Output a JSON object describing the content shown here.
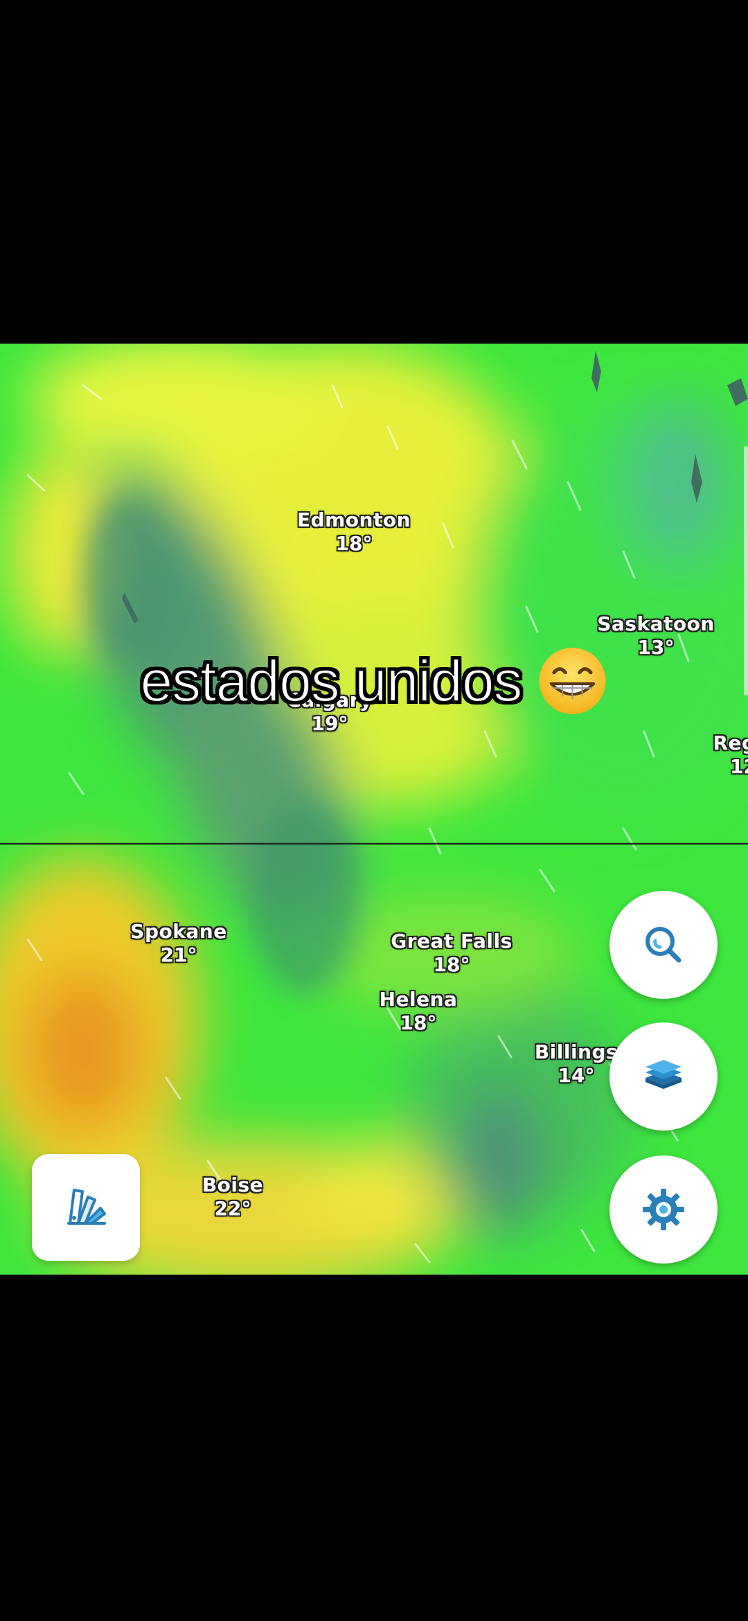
{
  "caption": {
    "text": "estados unidos",
    "emoji": "grinning-face-with-smiling-eyes"
  },
  "map": {
    "cities": [
      {
        "name": "Edmonton",
        "temp": "18°"
      },
      {
        "name": "Saskatoon",
        "temp": "13°"
      },
      {
        "name": "Calgary",
        "temp": "19°"
      },
      {
        "name": "Reg",
        "temp": "12"
      },
      {
        "name": "Spokane",
        "temp": "21°"
      },
      {
        "name": "Great Falls",
        "temp": "18°"
      },
      {
        "name": "Helena",
        "temp": "18°"
      },
      {
        "name": "Billings",
        "temp": "14°"
      },
      {
        "name": "Boise",
        "temp": "22°"
      }
    ]
  },
  "controls": {
    "search_icon": "search-location-icon",
    "layers_icon": "layers-icon",
    "settings_icon": "gear-icon",
    "legend_icon": "color-palette-icon"
  },
  "colors": {
    "accent": "#2a7fb8",
    "accent_light": "#4fb3e8"
  }
}
